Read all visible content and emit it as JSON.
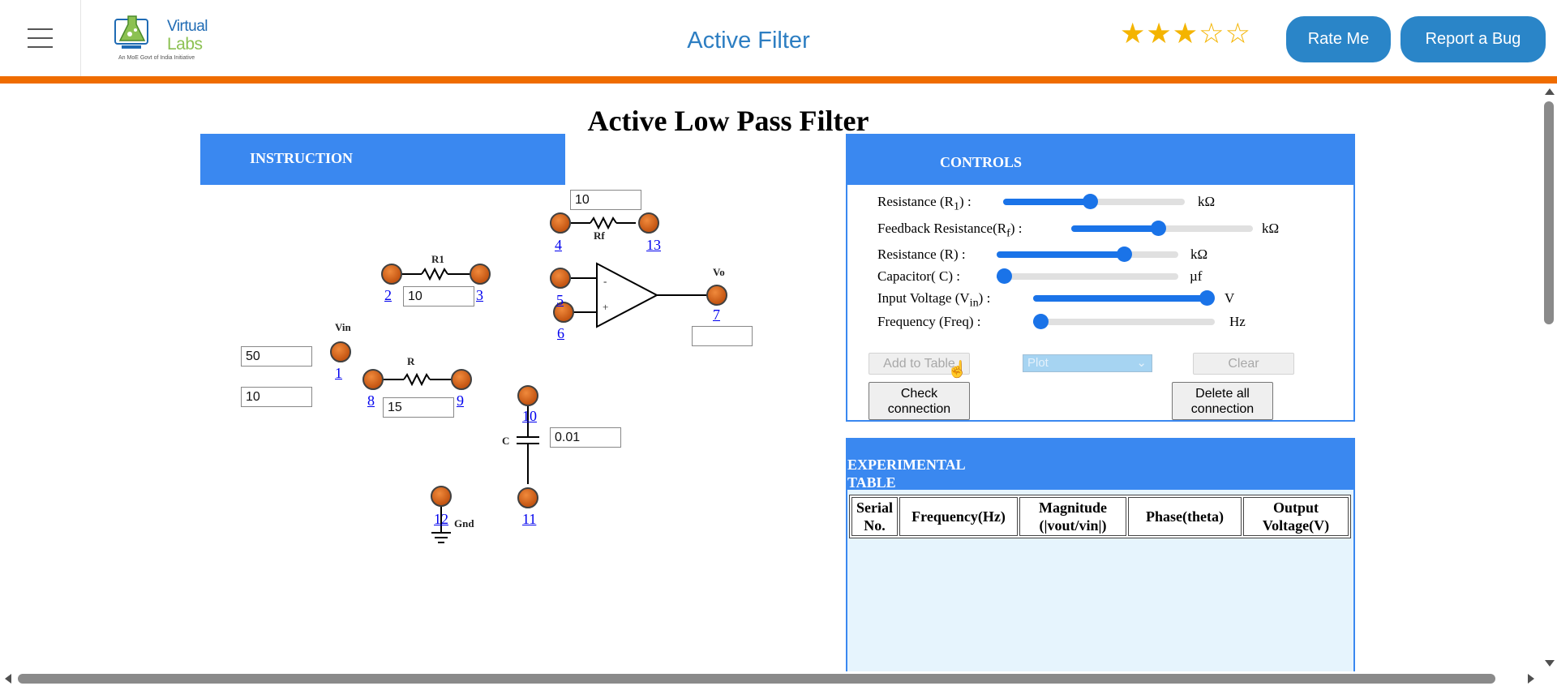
{
  "header": {
    "menu_icon": "hamburger-icon",
    "logo": {
      "line1": "Virtual",
      "line2": "Labs",
      "tagline": "An MoE Govt of India Initiative"
    },
    "title": "Active Filter",
    "rating": {
      "value": 3,
      "max": 5
    },
    "rate_button": "Rate Me",
    "bug_button": "Report a Bug"
  },
  "sim": {
    "title": "Active Low Pass Filter",
    "instruction_label": "INSTRUCTION"
  },
  "circuit": {
    "nodes": [
      "1",
      "2",
      "3",
      "4",
      "5",
      "6",
      "7",
      "8",
      "9",
      "10",
      "11",
      "12",
      "13"
    ],
    "labels": {
      "r1": "R1",
      "rf": "Rf",
      "vo": "Vo",
      "vin": "Vin",
      "r": "R",
      "c": "C",
      "gnd": "Gnd",
      "minus": "-",
      "plus": "+"
    },
    "values": {
      "rf": "10",
      "r1": "10",
      "vin": "50",
      "freq": "10",
      "r": "15",
      "c": "0.01",
      "vo": ""
    }
  },
  "controls": {
    "heading": "CONTROLS",
    "rows": [
      {
        "label": "Resistance (R",
        "sub": "1",
        "tail": ") :",
        "unit": "kΩ",
        "value_fraction": 0.48
      },
      {
        "label": "Feedback Resistance(R",
        "sub": "f",
        "tail": ") :",
        "unit": "kΩ",
        "value_fraction": 0.48
      },
      {
        "label": "Resistance (R) :",
        "sub": "",
        "tail": "",
        "unit": "kΩ",
        "value_fraction": 0.72
      },
      {
        "label": "Capacitor( C) :",
        "sub": "",
        "tail": "",
        "unit": "µf",
        "value_fraction": 0.0
      },
      {
        "label": "Input Voltage (V",
        "sub": "in",
        "tail": ") :",
        "unit": "V",
        "value_fraction": 1.0
      },
      {
        "label": "Frequency (Freq) :",
        "sub": "",
        "tail": "",
        "unit": "Hz",
        "value_fraction": 0.0
      }
    ],
    "add_to_table": "Add to Table",
    "plot_select": "Plot",
    "clear": "Clear",
    "check_connection": [
      "Check",
      "connection"
    ],
    "delete_connection": [
      "Delete all",
      "connection"
    ]
  },
  "experimental": {
    "heading": [
      "EXPERIMENTAL",
      "TABLE"
    ],
    "columns": [
      [
        "Serial",
        "No."
      ],
      [
        "Frequency(Hz)"
      ],
      [
        "Magnitude",
        "(|vout/vin|)"
      ],
      [
        "Phase(theta)"
      ],
      [
        "Output",
        "Voltage(V)"
      ]
    ]
  },
  "colors": {
    "accent": "#3a88f0",
    "brand": "#2a85c8",
    "orange_bar": "#ef6c00",
    "node": "#d0631c"
  }
}
